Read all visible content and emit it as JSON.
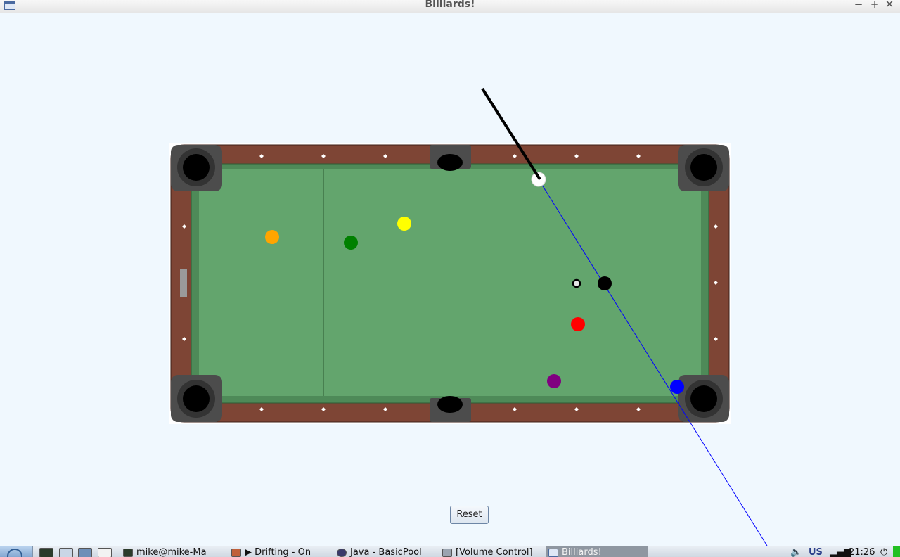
{
  "window": {
    "title": "Billiards!",
    "controls": {
      "minimize": "−",
      "maximize": "+",
      "close": "✕"
    }
  },
  "game": {
    "reset_label": "Reset",
    "colors": {
      "felt": "#63a56d",
      "felt_dark": "#4e8a58",
      "rail": "#7e4535",
      "pocket_frame": "#4c4c4c",
      "pocket": "#000000",
      "diamond": "#ffffff",
      "cue_stick": "#000000",
      "aim_line": "#0000ff"
    },
    "balls": [
      {
        "name": "cue-ball",
        "color": "#ffffff"
      },
      {
        "name": "orange-ball",
        "color": "#ffa500"
      },
      {
        "name": "green-ball",
        "color": "#008000"
      },
      {
        "name": "yellow-ball",
        "color": "#ffff00"
      },
      {
        "name": "black-ball",
        "color": "#000000"
      },
      {
        "name": "red-ball",
        "color": "#ff0000"
      },
      {
        "name": "purple-ball",
        "color": "#800080"
      },
      {
        "name": "blue-ball",
        "color": "#0000ff"
      }
    ]
  },
  "taskbar": {
    "launchers": [
      "terminal-icon",
      "file-manager-icon",
      "network-icon",
      "window-icon"
    ],
    "tasks": [
      {
        "label": "mike@mike-Ma",
        "icon": "terminal-icon",
        "active": false
      },
      {
        "label": "▶ Drifting - On",
        "icon": "media-player-icon",
        "active": false
      },
      {
        "label": "Java - BasicPool",
        "icon": "java-icon",
        "active": false
      },
      {
        "label": "[Volume Control]",
        "icon": "volume-control-icon",
        "active": false
      },
      {
        "label": "Billiards!",
        "icon": "window-icon",
        "active": true
      }
    ],
    "tray": {
      "keyboard_layout": "US",
      "clock": "21:26"
    }
  }
}
